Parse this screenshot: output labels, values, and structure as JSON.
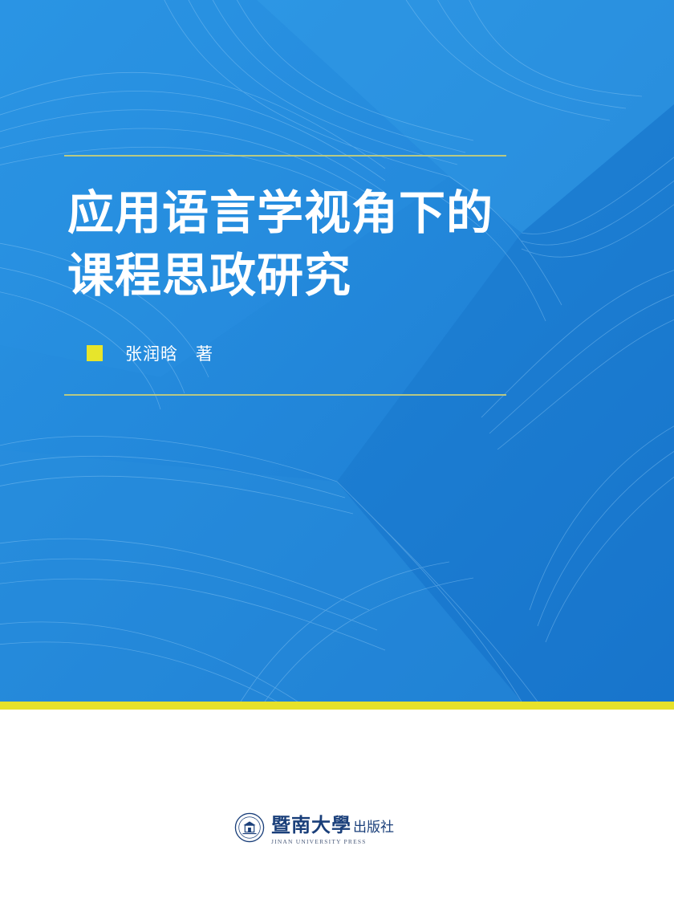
{
  "cover": {
    "title_line1": "应用语言学视角下的",
    "title_line2": "课程思政研究",
    "author": "张润晗",
    "author_role": "著",
    "publisher_name": "暨南大學",
    "publisher_suffix": "出版社",
    "publisher_english": "JINAN UNIVERSITY PRESS",
    "seal_text": "暨南大學"
  },
  "colors": {
    "background_blue": "#1f86d8",
    "accent_yellow": "#e6e12a",
    "rule_color": "#c9cf7a",
    "publisher_navy": "#1a3f7a"
  }
}
